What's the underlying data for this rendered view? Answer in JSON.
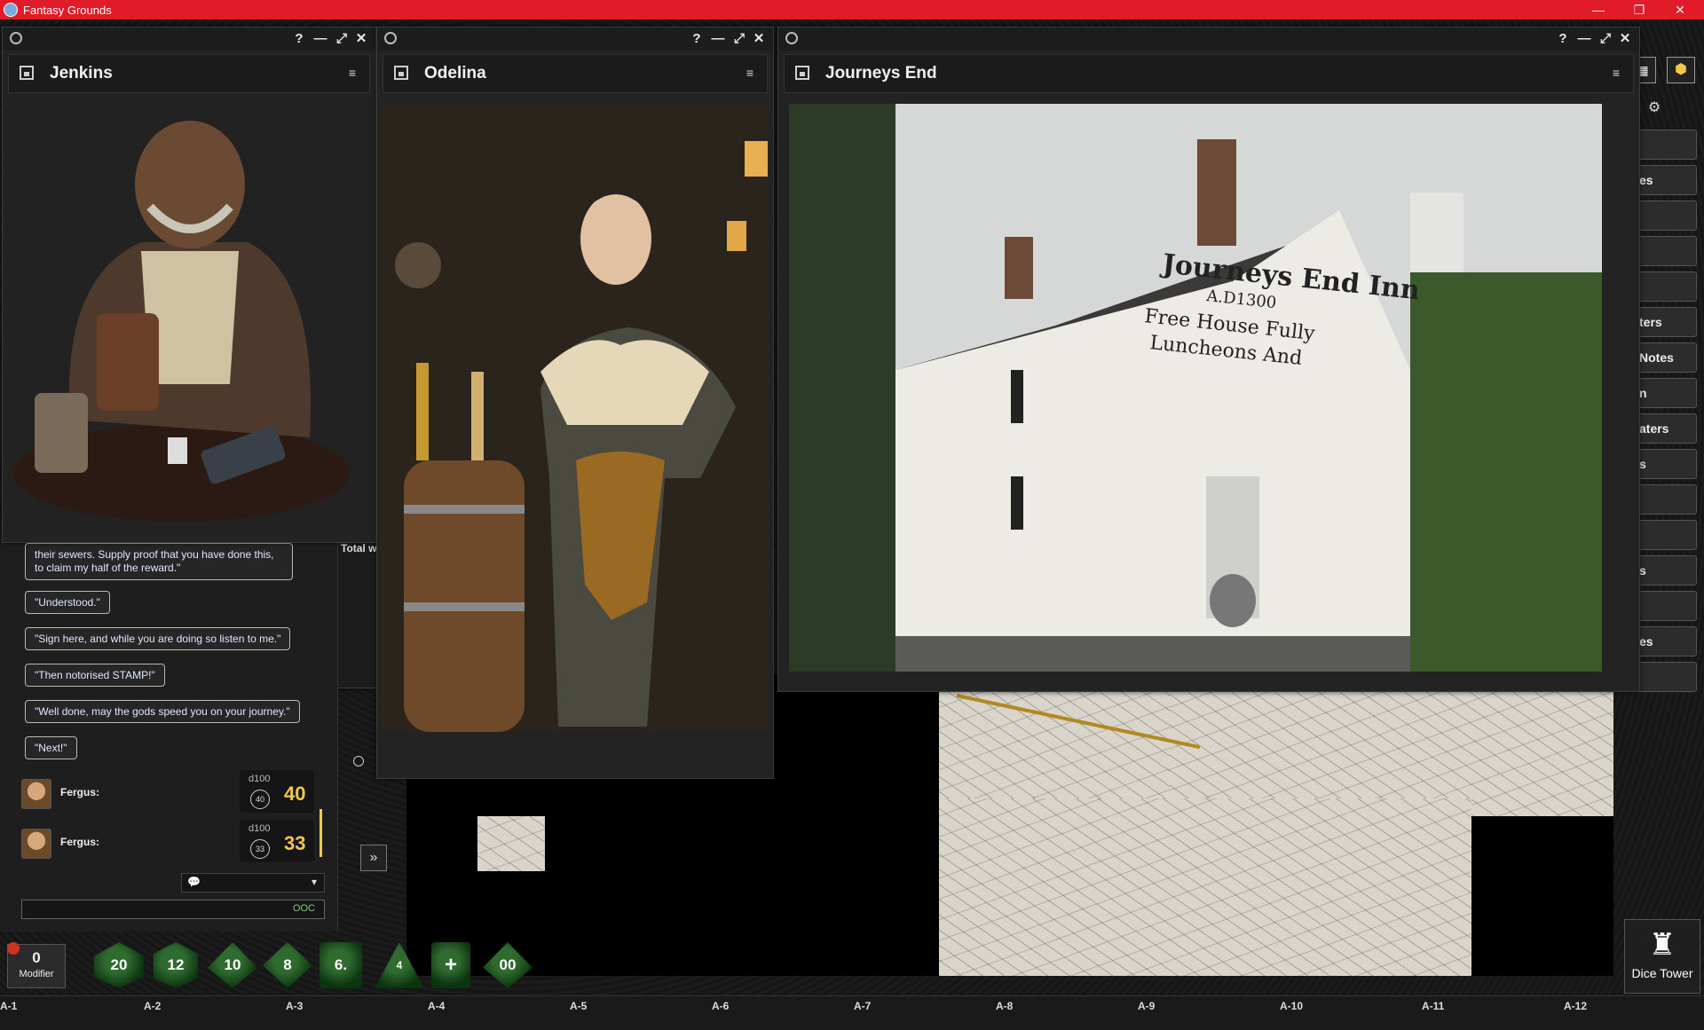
{
  "app": {
    "title": "Fantasy Grounds",
    "window_controls": [
      "—",
      "❐",
      "✕"
    ]
  },
  "windows": {
    "jenkins": {
      "title": "Jenkins"
    },
    "odelina": {
      "title": "Odelina"
    },
    "journeys_end": {
      "title": "Journeys End",
      "sign_lines": [
        "Journeys End Inn",
        "A.D1300",
        "Free House Fully",
        "Luncheons And"
      ]
    },
    "window_buttons": {
      "help": "?",
      "minimize": "—",
      "maximize": "⤢",
      "close": "✕"
    }
  },
  "chat": {
    "messages": [
      "their sewers. Supply proof that you have done this, to claim my half of the reward.\"",
      "\"Understood.\"",
      "\"Sign here, and while you are doing so listen to me.\"",
      "\"Then notorised STAMP!\"",
      "\"Well done, may the gods speed you on your journey.\"",
      "\"Next!\""
    ],
    "rolls": [
      {
        "who": "Fergus:",
        "die": "d100",
        "face": "40",
        "total": "40"
      },
      {
        "who": "Fergus:",
        "die": "d100",
        "face": "33",
        "total": "33"
      }
    ],
    "ooc_label": "OOC",
    "partial_text": "Total w"
  },
  "dice_bar": {
    "modifier_value": "0",
    "modifier_label": "Modifier",
    "dice": [
      "20",
      "12",
      "10",
      "8",
      "6.",
      "4",
      "+",
      "00"
    ]
  },
  "sidebar": {
    "buttons": [
      "es",
      "ters",
      "Notes",
      "n",
      "aters",
      "s",
      "s",
      "es"
    ],
    "dice_tower_label": "Dice Tower"
  },
  "ruler": [
    "A-1",
    "A-2",
    "A-3",
    "A-4",
    "A-5",
    "A-6",
    "A-7",
    "A-8",
    "A-9",
    "A-10",
    "A-11",
    "A-12"
  ],
  "colors": {
    "titlebar": "#e21b2b",
    "dice_green": "#1f5a24",
    "roll_total": "#f2c84a",
    "ooc": "#7fd17f"
  }
}
